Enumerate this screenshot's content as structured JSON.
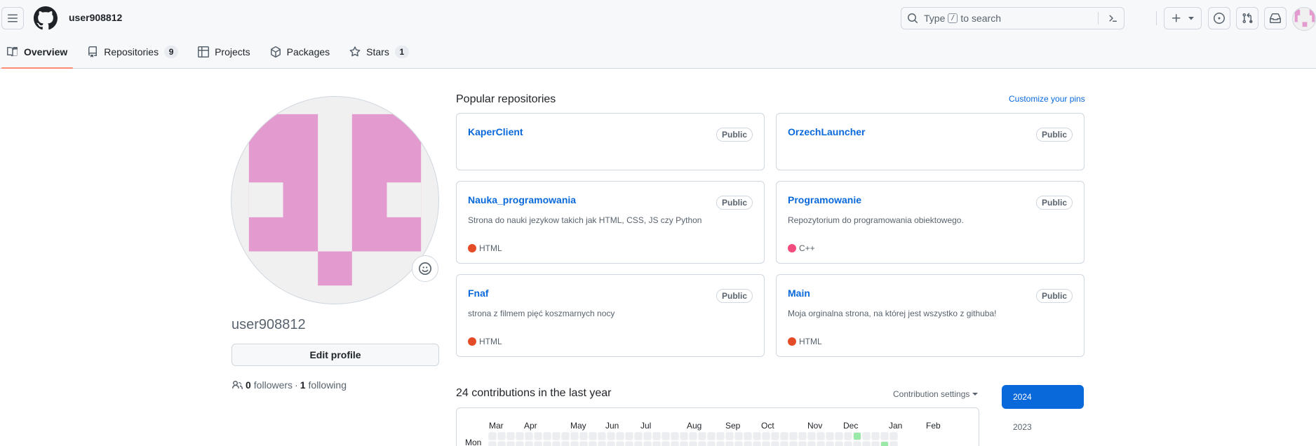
{
  "header": {
    "username": "user908812",
    "search": {
      "prefix": "Type",
      "key": "/",
      "suffix": "to search"
    }
  },
  "tabs": [
    {
      "label": "Overview",
      "icon": "book-icon",
      "selected": true
    },
    {
      "label": "Repositories",
      "icon": "repo-icon",
      "count": "9"
    },
    {
      "label": "Projects",
      "icon": "table-icon"
    },
    {
      "label": "Packages",
      "icon": "package-icon"
    },
    {
      "label": "Stars",
      "icon": "star-icon",
      "count": "1"
    }
  ],
  "profile": {
    "name": "user908812",
    "edit_label": "Edit profile",
    "followers_count": "0",
    "followers_label": "followers",
    "sep": "·",
    "following_count": "1",
    "following_label": "following"
  },
  "popular": {
    "title": "Popular repositories",
    "customize": "Customize your pins",
    "repos": [
      {
        "name": "KaperClient",
        "visibility": "Public",
        "description": "",
        "language": "",
        "lang_color": ""
      },
      {
        "name": "OrzechLauncher",
        "visibility": "Public",
        "description": "",
        "language": "",
        "lang_color": ""
      },
      {
        "name": "Nauka_programowania",
        "visibility": "Public",
        "description": "Strona do nauki jezykow takich jak HTML, CSS, JS czy Python",
        "language": "HTML",
        "lang_color": "#e34c26"
      },
      {
        "name": "Programowanie",
        "visibility": "Public",
        "description": "Repozytorium do programowania obiektowego.",
        "language": "C++",
        "lang_color": "#f34b7d"
      },
      {
        "name": "Fnaf",
        "visibility": "Public",
        "description": "strona z filmem pięć koszmarnych nocy",
        "language": "HTML",
        "lang_color": "#e34c26"
      },
      {
        "name": "Main",
        "visibility": "Public",
        "description": "Moja orginalna strona, na której jest wszystko z githuba!",
        "language": "HTML",
        "lang_color": "#e34c26"
      }
    ]
  },
  "contributions": {
    "title": "24 contributions in the last year",
    "settings": "Contribution settings",
    "months": [
      "Mar",
      "Apr",
      "May",
      "Jun",
      "Jul",
      "Aug",
      "Sep",
      "Oct",
      "Nov",
      "Dec",
      "Jan",
      "Feb"
    ],
    "day_label": "Mon",
    "years": [
      "2024",
      "2023"
    ]
  },
  "colors": {
    "accent": "#0969da",
    "tab_underline": "#fd8c73",
    "avatar_pink": "#e39bcf",
    "contrib_level1": "#9be9a8"
  }
}
